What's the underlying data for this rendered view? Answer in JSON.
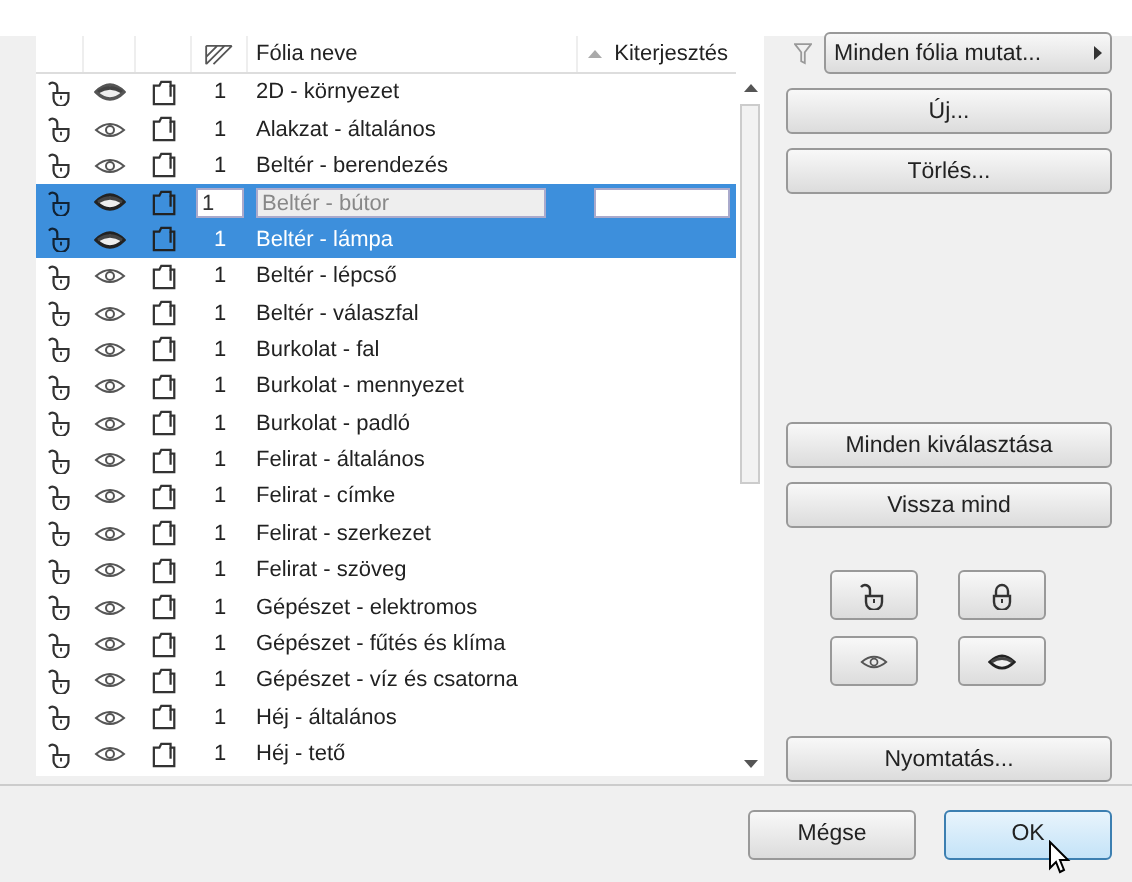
{
  "table": {
    "columns": {
      "name": "Fólia neve",
      "extension": "Kiterjesztés",
      "extension_sorted": true
    },
    "rows": [
      {
        "locked": false,
        "eye_solid": true,
        "number": "1",
        "name": "2D - környezet",
        "selected": false,
        "editing": false
      },
      {
        "locked": false,
        "eye_solid": false,
        "number": "1",
        "name": "Alakzat - általános",
        "selected": false,
        "editing": false
      },
      {
        "locked": false,
        "eye_solid": false,
        "number": "1",
        "name": "Beltér - berendezés",
        "selected": false,
        "editing": false
      },
      {
        "locked": false,
        "eye_solid": true,
        "number": "1",
        "name": "Beltér - bútor",
        "selected": true,
        "editing": true
      },
      {
        "locked": false,
        "eye_solid": true,
        "number": "1",
        "name": "Beltér - lámpa",
        "selected": true,
        "editing": false
      },
      {
        "locked": false,
        "eye_solid": false,
        "number": "1",
        "name": "Beltér - lépcső",
        "selected": false,
        "editing": false
      },
      {
        "locked": false,
        "eye_solid": false,
        "number": "1",
        "name": "Beltér - válaszfal",
        "selected": false,
        "editing": false
      },
      {
        "locked": false,
        "eye_solid": false,
        "number": "1",
        "name": "Burkolat - fal",
        "selected": false,
        "editing": false
      },
      {
        "locked": false,
        "eye_solid": false,
        "number": "1",
        "name": "Burkolat - mennyezet",
        "selected": false,
        "editing": false
      },
      {
        "locked": false,
        "eye_solid": false,
        "number": "1",
        "name": "Burkolat - padló",
        "selected": false,
        "editing": false
      },
      {
        "locked": false,
        "eye_solid": false,
        "number": "1",
        "name": "Felirat - általános",
        "selected": false,
        "editing": false
      },
      {
        "locked": false,
        "eye_solid": false,
        "number": "1",
        "name": "Felirat - címke",
        "selected": false,
        "editing": false
      },
      {
        "locked": false,
        "eye_solid": false,
        "number": "1",
        "name": "Felirat - szerkezet",
        "selected": false,
        "editing": false
      },
      {
        "locked": false,
        "eye_solid": false,
        "number": "1",
        "name": "Felirat - szöveg",
        "selected": false,
        "editing": false
      },
      {
        "locked": false,
        "eye_solid": false,
        "number": "1",
        "name": "Gépészet - elektromos",
        "selected": false,
        "editing": false
      },
      {
        "locked": false,
        "eye_solid": false,
        "number": "1",
        "name": "Gépészet - fűtés és klíma",
        "selected": false,
        "editing": false
      },
      {
        "locked": false,
        "eye_solid": false,
        "number": "1",
        "name": "Gépészet - víz és csatorna",
        "selected": false,
        "editing": false
      },
      {
        "locked": false,
        "eye_solid": false,
        "number": "1",
        "name": "Héj - általános",
        "selected": false,
        "editing": false
      },
      {
        "locked": false,
        "eye_solid": false,
        "number": "1",
        "name": "Héj - tető",
        "selected": false,
        "editing": false
      }
    ]
  },
  "side_panel": {
    "filter_button": "Minden fólia mutat...",
    "new_button": "Új...",
    "delete_button": "Törlés...",
    "select_all_button": "Minden kiválasztása",
    "reset_button": "Vissza mind",
    "print_button": "Nyomtatás..."
  },
  "footer": {
    "cancel_button": "Mégse",
    "ok_button": "OK"
  }
}
